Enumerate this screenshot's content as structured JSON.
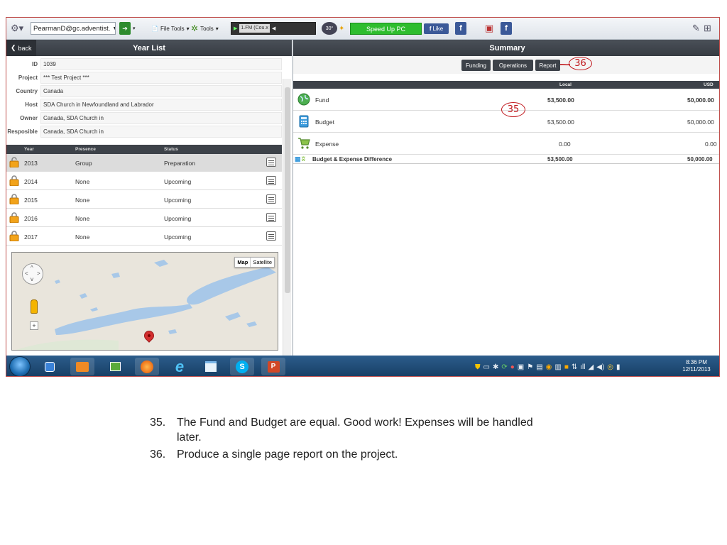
{
  "toolbar": {
    "account": "PearmanD@gc.adventist.",
    "file_tools": "File Tools",
    "tools": "Tools",
    "radio_station": "1.FM (Cou.x",
    "temperature": "30°",
    "speed_up": "Speed Up PC",
    "like": "Like"
  },
  "left_panel": {
    "back": "back",
    "title": "Year List",
    "fields": [
      {
        "label": "ID",
        "value": "1039"
      },
      {
        "label": "Project",
        "value": "*** Test Project ***"
      },
      {
        "label": "Country",
        "value": "Canada"
      },
      {
        "label": "Host",
        "value": "SDA Church in Newfoundland and Labrador"
      },
      {
        "label": "Owner",
        "value": "Canada, SDA Church in"
      },
      {
        "label": "Resposible",
        "value": "Canada, SDA Church in"
      }
    ],
    "columns": [
      "Year",
      "Presence",
      "Status"
    ],
    "years": [
      {
        "year": "2013",
        "presence": "Group",
        "status": "Preparation",
        "selected": true
      },
      {
        "year": "2014",
        "presence": "None",
        "status": "Upcoming",
        "selected": false
      },
      {
        "year": "2015",
        "presence": "None",
        "status": "Upcoming",
        "selected": false
      },
      {
        "year": "2016",
        "presence": "None",
        "status": "Upcoming",
        "selected": false
      },
      {
        "year": "2017",
        "presence": "None",
        "status": "Upcoming",
        "selected": false
      }
    ],
    "map_types": [
      "Map",
      "Satellite"
    ]
  },
  "right_panel": {
    "title": "Summary",
    "tabs": [
      "Funding",
      "Operations",
      "Report"
    ],
    "columns": {
      "local": "Local",
      "usd": "USD"
    },
    "rows": [
      {
        "label": "Fund",
        "local": "53,500.00",
        "usd": "50,000.00",
        "bold": true,
        "icon": "globe-icon"
      },
      {
        "label": "Budget",
        "local": "53,500.00",
        "usd": "50,000.00",
        "bold": false,
        "icon": "calculator-icon"
      },
      {
        "label": "Expense",
        "local": "0.00",
        "usd": "0.00",
        "bold": false,
        "icon": "cart-icon"
      }
    ],
    "difference": {
      "label": "Budget & Expense Difference",
      "local": "53,500.00",
      "usd": "50,000.00"
    }
  },
  "annotations": {
    "report": "36",
    "fund": "35"
  },
  "taskbar": {
    "time": "8:36 PM",
    "date": "12/11/2013"
  },
  "notes": [
    {
      "number": "35.",
      "text": "The Fund and Budget are equal. Good work!  Expenses will be handled later."
    },
    {
      "number": "36.",
      "text": "Produce a single page report on the project."
    }
  ],
  "colors": {
    "accent_green": "#2ebd2e",
    "header_dark": "#3d4249",
    "annotation_red": "#c0161b",
    "facebook_blue": "#3b5998"
  }
}
